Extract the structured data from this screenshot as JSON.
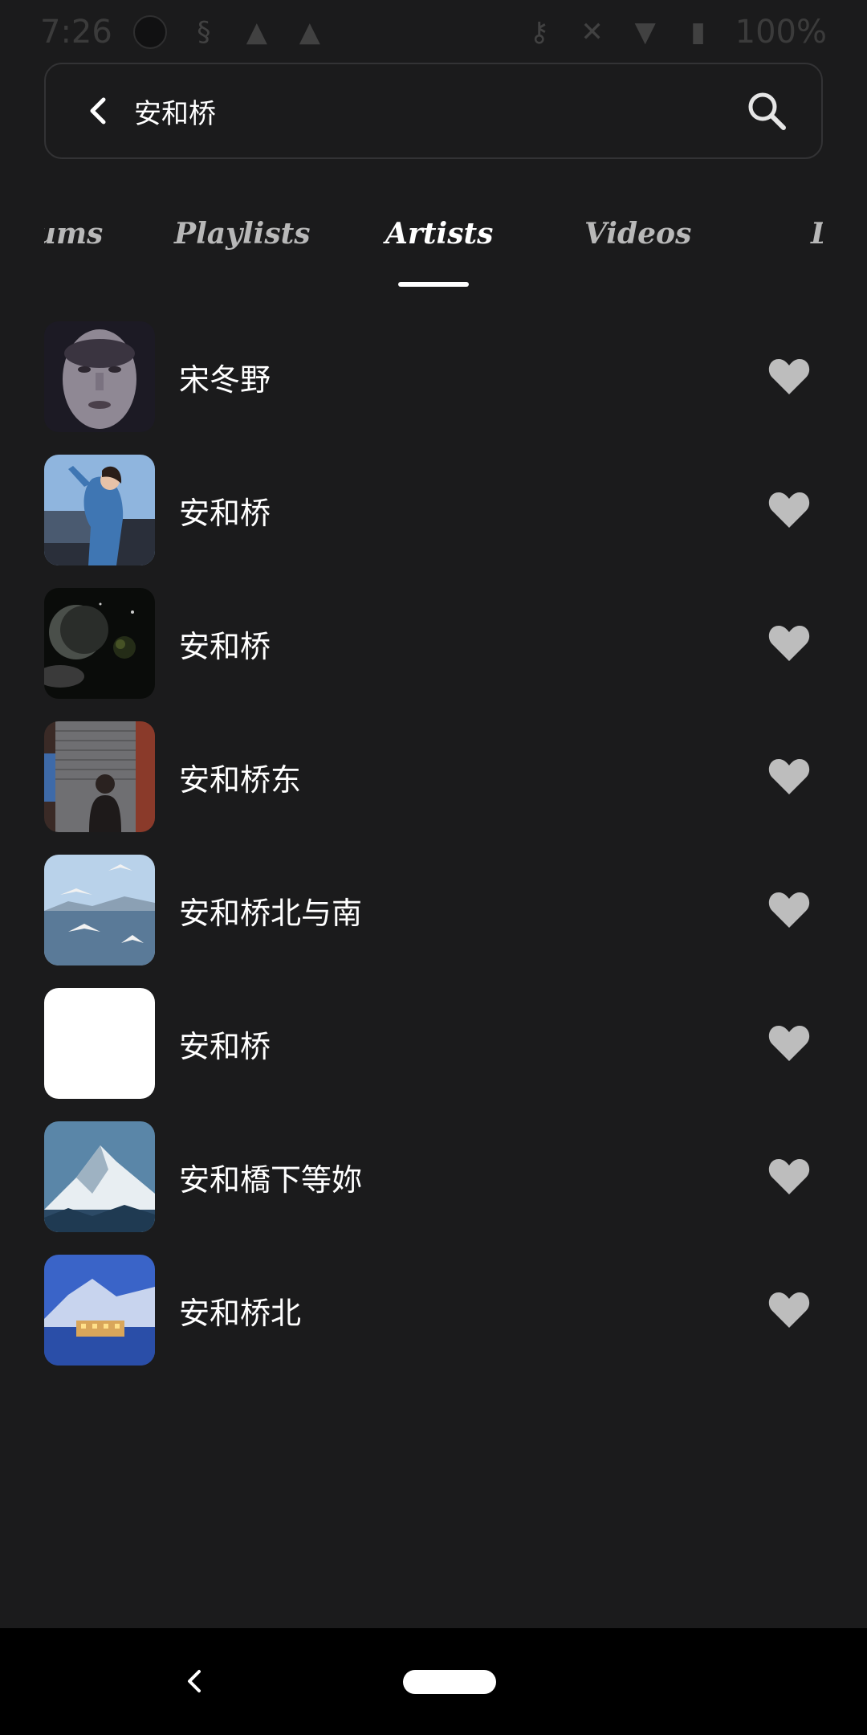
{
  "status_bar": {
    "time": "7:26",
    "battery": "100%"
  },
  "search": {
    "query": "安和桥"
  },
  "tabs": [
    {
      "label": "Albums",
      "active": false
    },
    {
      "label": "Playlists",
      "active": false
    },
    {
      "label": "Artists",
      "active": true
    },
    {
      "label": "Videos",
      "active": false
    },
    {
      "label": "D",
      "active": false
    }
  ],
  "artists": [
    {
      "name": "宋冬野",
      "thumb": "face-portrait"
    },
    {
      "name": "安和桥",
      "thumb": "woman-blue-dress"
    },
    {
      "name": "安和桥",
      "thumb": "space-planet"
    },
    {
      "name": "安和桥东",
      "thumb": "man-street"
    },
    {
      "name": "安和桥北与南",
      "thumb": "seagulls-sea"
    },
    {
      "name": "安和桥",
      "thumb": "blank-white"
    },
    {
      "name": "安和橋下等妳",
      "thumb": "mountain-snow"
    },
    {
      "name": "安和桥北",
      "thumb": "lake-town"
    }
  ],
  "colors": {
    "background": "#1b1b1c",
    "heart": "#bdbdbd",
    "active_tab": "#ffffff",
    "inactive_tab": "#b8b8b8"
  }
}
